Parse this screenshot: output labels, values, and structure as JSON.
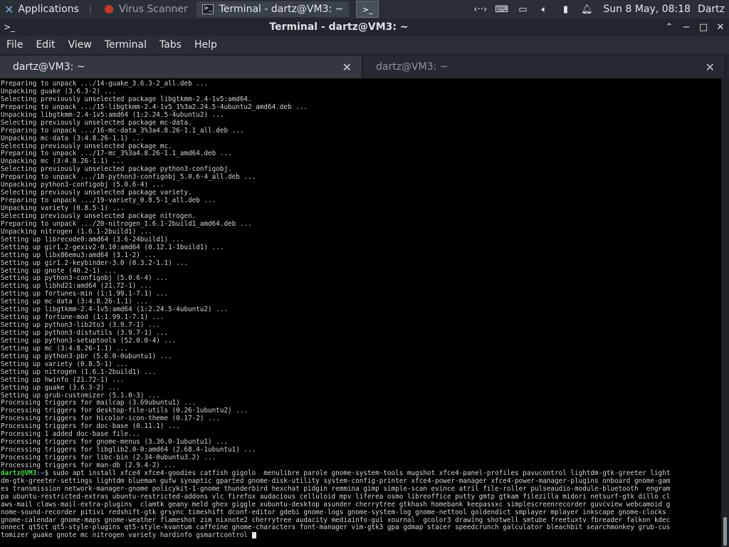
{
  "panel": {
    "applications_label": "Applications",
    "tasks": [
      {
        "label": "Virus Scanner",
        "active": false
      },
      {
        "label": "Terminal - dartz@VM3: ~",
        "active": true
      }
    ],
    "clock": "Sun  8 May, 08:18",
    "user": "Dartz"
  },
  "window": {
    "title": "Terminal - dartz@VM3: ~"
  },
  "menu": [
    "File",
    "Edit",
    "View",
    "Terminal",
    "Tabs",
    "Help"
  ],
  "tabs": [
    {
      "label": "dartz@VM3: ~",
      "active": true
    },
    {
      "label": "dartz@VM3: ~",
      "active": false
    }
  ],
  "terminal": {
    "lines": [
      "Preparing to unpack .../14-guake_3.6.3-2_all.deb ...",
      "Unpacking guake (3.6.3-2) ...",
      "Selecting previously unselected package libgtkmm-2.4-1v5:amd64.",
      "Preparing to unpack .../15-libgtkmm-2.4-1v5_1%3a2.24.5-4ubuntu2_amd64.deb ...",
      "Unpacking libgtkmm-2.4-1v5:amd64 (1:2.24.5-4ubuntu2) ...",
      "Selecting previously unselected package mc-data.",
      "Preparing to unpack .../16-mc-data_3%3a4.8.26-1.1_all.deb ...",
      "Unpacking mc-data (3:4.8.26-1.1) ...",
      "Selecting previously unselected package mc.",
      "Preparing to unpack .../17-mc_3%3a4.8.26-1.1_amd64.deb ...",
      "Unpacking mc (3:4.8.26-1.1) ...",
      "Selecting previously unselected package python3-configobj.",
      "Preparing to unpack .../18-python3-configobj_5.0.6-4_all.deb ...",
      "Unpacking python3-configobj (5.0.6-4) ...",
      "Selecting previously unselected package variety.",
      "Preparing to unpack .../19-variety_0.8.5-1_all.deb ...",
      "Unpacking variety (0.8.5-1) ...",
      "Selecting previously unselected package nitrogen.",
      "Preparing to unpack .../20-nitrogen_1.6.1-2build1_amd64.deb ...",
      "Unpacking nitrogen (1.6.1-2build1) ...",
      "Setting up librecode0:amd64 (3.6-24build1) ...",
      "Setting up gir1.2-gexiv2-0.10:amd64 (0.12.1-1build1) ...",
      "Setting up libx86emu3:amd64 (3.1-2) ...",
      "Setting up gir1.2-keybinder-3.0 (0.3.2-1.1) ...",
      "Setting up gnote (40.2-1) ...",
      "Setting up python3-configobj (5.0.6-4) ...",
      "Setting up libhd21:amd64 (21.72-1) ...",
      "Setting up fortunes-min (1:1.99.1-7.1) ...",
      "Setting up mc-data (3:4.8.26-1.1) ...",
      "Setting up libgtkmm-2.4-1v5:amd64 (1:2.24.5-4ubuntu2) ...",
      "Setting up fortune-mod (1:1.99.1-7.1) ...",
      "Setting up python3-lib2to3 (3.9.7-1) ...",
      "Setting up python3-distutils (3.9.7-1) ...",
      "Setting up python3-setuptools (52.0.0-4) ...",
      "Setting up mc (3:4.8.26-1.1) ...",
      "Setting up python3-pbr (5.6.0-0ubuntu1) ...",
      "Setting up variety (0.8.5-1) ...",
      "Setting up nitrogen (1.6.1-2build1) ...",
      "Setting up hwinfo (21.72-1) ...",
      "Setting up guake (3.6.3-2) ...",
      "Setting up grub-customizer (5.1.0-3) ...",
      "Processing triggers for mailcap (3.69ubuntu1) ...",
      "Processing triggers for desktop-file-utils (0.26-1ubuntu2) ...",
      "Processing triggers for hicolor-icon-theme (0.17-2) ...",
      "Processing triggers for doc-base (0.11.1) ...",
      "Processing 1 added doc-base file...",
      "Processing triggers for gnome-menus (3.36.0-1ubuntu1) ...",
      "Processing triggers for libglib2.0-0:amd64 (2.68.4-1ubuntu1) ...",
      "Processing triggers for libc-bin (2.34-0ubuntu3.2) ...",
      "Processing triggers for man-db (2.9.4-2) ..."
    ],
    "prompt_user": "dartz@VM3",
    "prompt_path": ":~",
    "prompt_symbol": "$",
    "command_lines": [
      " sudo apt install xfce4 xfce4-goodies catfish gigolo  menulibre parole gnome-system-tools mugshot xfce4-panel-profiles pavucontrol lightdm-gtk-greeter light",
      "dm-gtk-greeter-settings lightdm blueman gufw synaptic gparted gnome-disk-utility system-config-printer xfce4-power-manager xfce4-power-manager-plugins onboard gnome-gam",
      "es transmission network-manager-gnome policykit-1-gnome thunderbird hexchat pidgin remmina gimp simple-scan evince atril file-roller pulseaudio-module-bluetooth  engram",
      "pa ubuntu-restricted-extras ubuntu-restricted-addons vlc firefox audacious celluloid mpv liferea osmo libreoffice putty gmtp gtkam filezilla midori netsurf-gtk dillo cl",
      "aws-mail claws-mail-extra-plugins  clamtk geany meld ghex giggle xubuntu-desktop asunder cherrytree gtkhash homebank keepassxc simplescreenrecorder guvcview webcamoid g",
      "nome-sound-recorder pitivi redshift-gtk grsync timeshift dconf-editor gdebi gnome-logs gnome-system-log gnome-nettool goldendict smplayer mplayer inkscape gnome-clocks",
      "gnome-calendar gnome-maps gnome-weather flameshot zim nixnote2 cherrytree audacity mediainfo-gui xournal  gcolor3 drawing shotwell smtube freetuxtv fbreader falkon kdec",
      "onnect qt5ct qt5-style-plugins qt5-style-kvantum caffeine gnome-characters font-manager vim-gtk3 gpa gdmap stacer speedcrunch galculator bleachbit searchmonkey grub-cus",
      "tomizer guake gnote mc nitrogen variety hardinfo gsmartcontrol "
    ]
  }
}
